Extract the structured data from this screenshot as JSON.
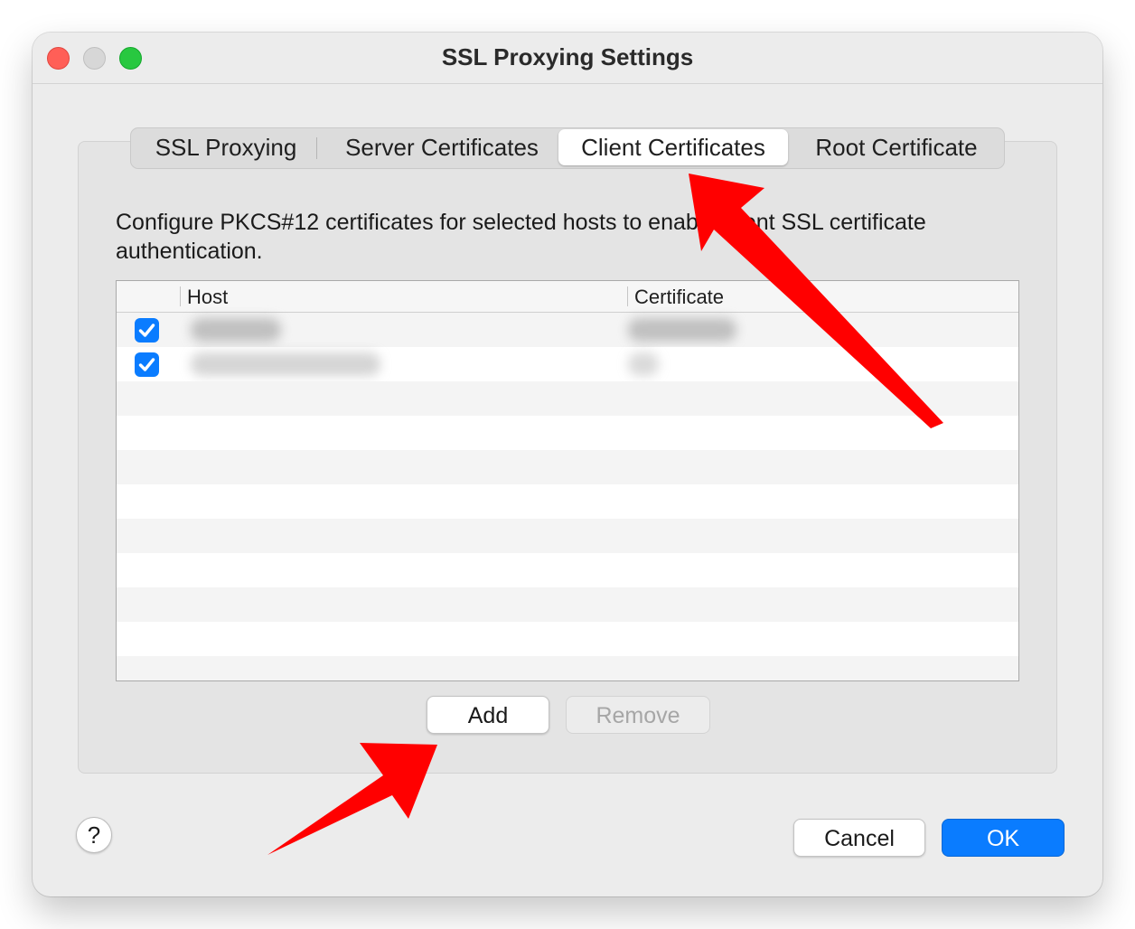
{
  "window": {
    "title": "SSL Proxying Settings"
  },
  "tabs": [
    {
      "label": "SSL Proxying",
      "active": false
    },
    {
      "label": "Server Certificates",
      "active": false
    },
    {
      "label": "Client Certificates",
      "active": true
    },
    {
      "label": "Root Certificate",
      "active": false
    }
  ],
  "description": "Configure PKCS#12 certificates for selected hosts to enable client SSL certificate authentication.",
  "table": {
    "columns": [
      "Host",
      "Certificate"
    ],
    "rows": [
      {
        "enabled": true,
        "host": "",
        "certificate": ""
      },
      {
        "enabled": true,
        "host": "",
        "certificate": ""
      }
    ]
  },
  "buttons": {
    "add": "Add",
    "remove": "Remove",
    "cancel": "Cancel",
    "ok": "OK",
    "help": "?"
  },
  "colors": {
    "accent": "#0a7cff",
    "annotation_arrow": "#ff0000",
    "close": "#ff5f57",
    "zoom": "#28c840"
  },
  "icons": {
    "close": "close-window-icon",
    "minimize": "minimize-window-icon",
    "zoom": "zoom-window-icon",
    "checkbox": "checkmark-icon",
    "arrow": "red-arrow-icon"
  }
}
